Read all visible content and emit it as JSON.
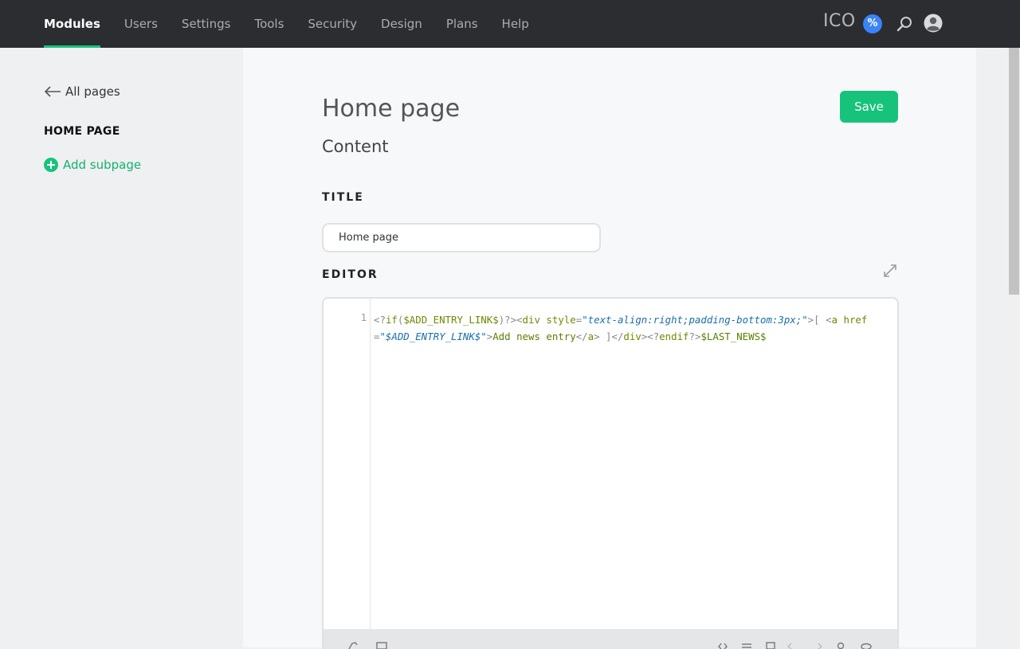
{
  "nav": {
    "items": [
      {
        "label": "Modules",
        "active": true
      },
      {
        "label": "Users",
        "active": false
      },
      {
        "label": "Settings",
        "active": false
      },
      {
        "label": "Tools",
        "active": false
      },
      {
        "label": "Security",
        "active": false
      },
      {
        "label": "Design",
        "active": false
      },
      {
        "label": "Plans",
        "active": false
      },
      {
        "label": "Help",
        "active": false
      }
    ],
    "brand": "ICO",
    "promo_badge": "%",
    "icons": [
      "percent-badge-icon",
      "search-icon",
      "user-avatar-icon"
    ]
  },
  "sidebar": {
    "back_label": "All pages",
    "current_page": "HOME PAGE",
    "add_subpage_label": "Add subpage"
  },
  "main": {
    "title": "Home page",
    "subtitle": "Content",
    "save_label": "Save",
    "title_section_label": "TITLE",
    "title_value": "Home page",
    "editor_section_label": "EDITOR",
    "editor": {
      "line_number": "1",
      "code": "<?if($ADD_ENTRY_LINK$)?><div style=\"text-align:right;padding-bottom:3px;\">[ <a href=\"$ADD_ENTRY_LINK$\">Add news entry</a> ]</div><?endif?>$LAST_NEWS$"
    }
  },
  "colors": {
    "topbar": "#2b2d30",
    "accent": "#17c37b",
    "badge": "#3b83f6",
    "sidebar_bg": "#eef0f1",
    "main_bg": "#f7f8f9"
  }
}
